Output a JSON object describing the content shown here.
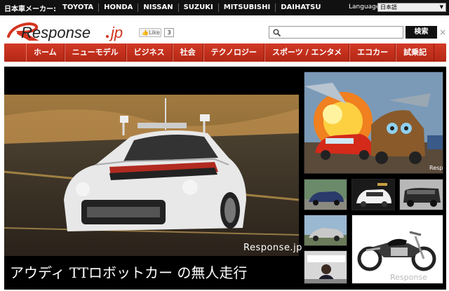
{
  "topbar": {
    "makers_label": "日本車メーカー:",
    "makers": [
      "TOYOTA",
      "HONDA",
      "NISSAN",
      "SUZUKI",
      "MITSUBISHI",
      "DAIHATSU"
    ],
    "language_label": "Language",
    "language_value": "日本語"
  },
  "header": {
    "logo_text": "Response",
    "logo_suffix": "jp",
    "like_label": "Like",
    "like_count": "3",
    "search_placeholder": "",
    "search_button": "検索"
  },
  "nav": {
    "items": [
      "ホーム",
      "ニューモデル",
      "ビジネス",
      "社会",
      "テクノロジー",
      "スポーツ / エンタメ",
      "エコカー",
      "試乗記"
    ]
  },
  "hero": {
    "watermark": "Response.jp",
    "caption": "アウディ TTロボットカー の無人走行"
  },
  "tiles": {
    "cars_watermark": "Resp",
    "moto_watermark": "Response"
  },
  "colors": {
    "nav_red": "#c4301c",
    "topbar": "#111111",
    "main_bg": "#000000"
  }
}
